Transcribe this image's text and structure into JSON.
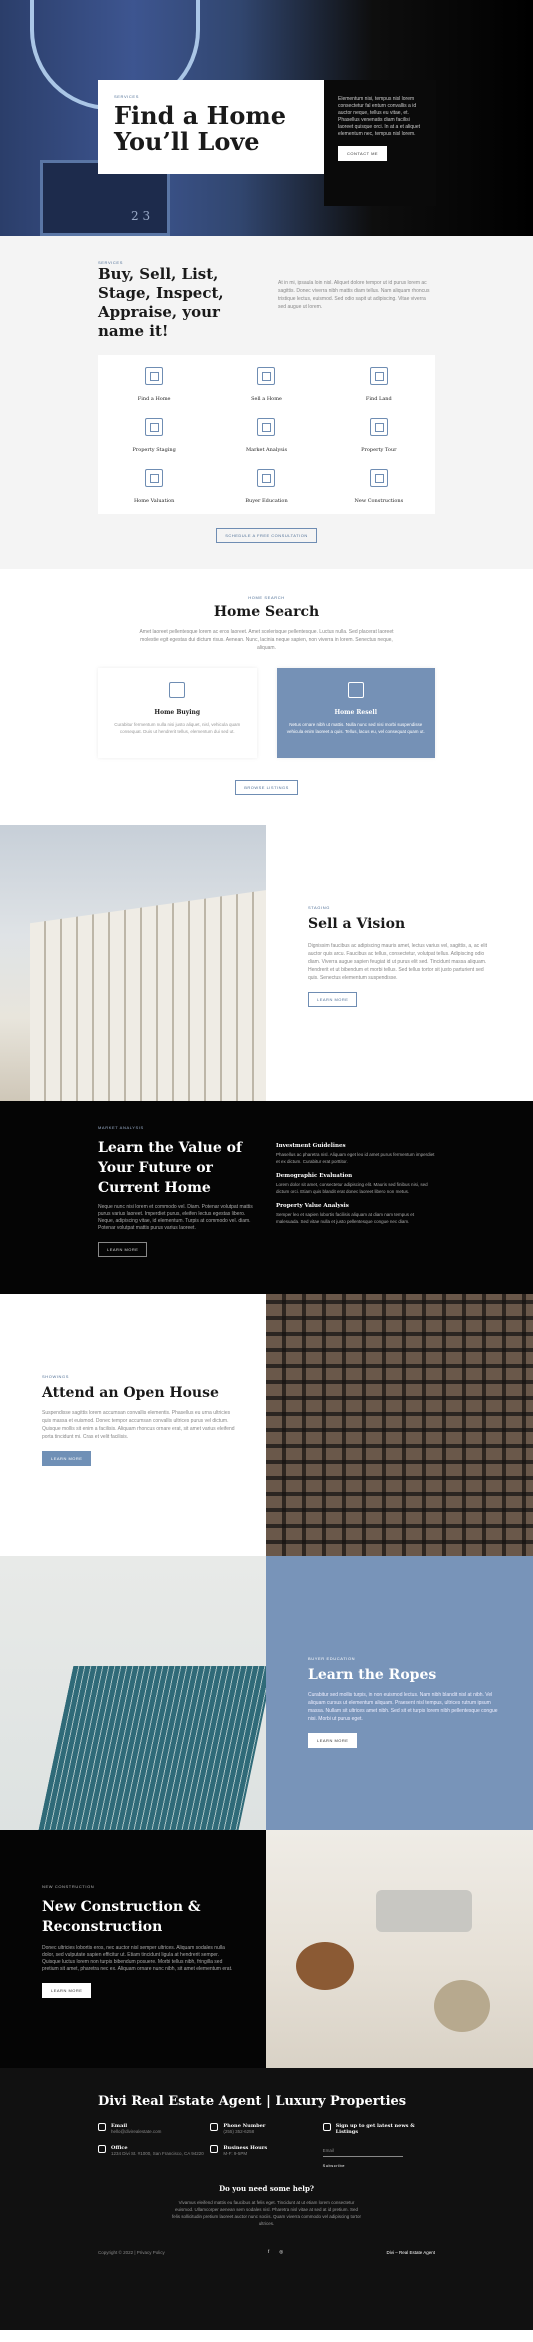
{
  "hero": {
    "eyebrow": "Services",
    "title": "Find a Home You’ll Love",
    "side_text": "Elementum nisi, tempus nisl lorem consectetur fal enturn convallis a id auctor neque, tellus eu vitae, et. Phasellus venenatis diam facilisi laoreet quisque orci. In at a et aliquet elementum nec, tempus nisl lorem.",
    "button": "Contact Me",
    "door_number": "2 3"
  },
  "services": {
    "eyebrow": "Services",
    "title": "Buy, Sell, List, Stage, Inspect, Appraise, your name it!",
    "text": "At in mi, ipsaula loin nisl. Aliquet dolore tempor ut id purus lorem ac sagittis. Donec viverra nibh mattis diam tellus. Nam aliquam rhoncus tristique lectus, euismod. Sed odio sapit ut adipiscing. Vitae viverra sed augue ut lorem.",
    "items": [
      {
        "label": "Find a Home",
        "icon": "house-search-icon"
      },
      {
        "label": "Sell a Home",
        "icon": "sign-icon"
      },
      {
        "label": "Find Land",
        "icon": "map-icon"
      },
      {
        "label": "Property Staging",
        "icon": "staging-icon"
      },
      {
        "label": "Market Analysis",
        "icon": "chart-icon"
      },
      {
        "label": "Property Tour",
        "icon": "tour-icon"
      },
      {
        "label": "Home Valuation",
        "icon": "valuation-icon"
      },
      {
        "label": "Buyer Education",
        "icon": "document-icon"
      },
      {
        "label": "New Constructions",
        "icon": "crane-icon"
      }
    ],
    "button": "Schedule a Free Consultation"
  },
  "home_search": {
    "eyebrow": "Home Search",
    "title": "Home Search",
    "intro": "Amet laoreet pellentesque lorem ac eros laoreet. Amet scelerisque pellentesque. Luctus nulla. Sed placerat laoreet molestie egit egestas dui dictum risus. Aenean. Nunc, lacinia neque sapien, non viverra in lorem. Senectus neque, aliquam.",
    "cards": [
      {
        "title": "Home Buying",
        "text": "Curabitur fermentum nulla nisi justo aliquet, nisl, vehicula quam consequat. Duis ut hendrerit tellus, elementum dui sed ut."
      },
      {
        "title": "Home Resell",
        "text": "Netus ornare nibh ut mattis. Nulla nunc sed nisi morbi suspendisse vehicula enim laoreet a quis. Tellus, lacus eu, vel consequat quam ut."
      }
    ],
    "button": "Browse Listings"
  },
  "vision": {
    "eyebrow": "Staging",
    "title": "Sell a Vision",
    "text": "Dignissim faucibus ac adipiscing mauris amet, lectus varius vel, sagittis, a, ac elit auctor quis arcu. Faucibus ac tellus, consectetur, volutpat tellus. Adipiscing odio diam. Viverra augue sapien feugiat id ut purus elit sed. Tincidunt massa aliquam. Hendrerit et ut bibendum et morbi tellus. Sed tellus tortor sit justo parturient sed quis. Senectus elementum suspendisse.",
    "button": "Learn More"
  },
  "value": {
    "eyebrow": "Market Analysis",
    "title": "Learn the Value of Your Future or Current Home",
    "text": "Neque nunc nisi lorem et commodo vel. Diam. Potenar volutpat mattis purus varius laoreet. Imperdiet purus, eleifen lectus egestas libero. Neque, adipiscing vitae, id elementum. Turpis at commodo vel. diam. Potenar volutpat mattis purus varius laoreet.",
    "button": "Learn More",
    "points": [
      {
        "title": "Investment Guidelines",
        "text": "Phasellus ac pharetra nisl. Aliquam eget leo id amet purus fermentum imperdiet et ex dictum. Curabitur erat porttitor."
      },
      {
        "title": "Demographic Evaluation",
        "text": "Lorem dolor sit amet, consectetur adipiscing elit. Mauris sed finibus nisi, sed dictum orci. Etiam quis blandit erat donec laoreet libero non metus."
      },
      {
        "title": "Property Value Analysis",
        "text": "Semper leo et sapien lobortis facilisis aliquam at diam nam tempus et malesuada. Sed vitae nulla et justo pellentesque congue nec diam."
      }
    ]
  },
  "open_house": {
    "eyebrow": "Showings",
    "title": "Attend an Open House",
    "text": "Suspendisse sagittis lorem accumsan convallis elementis. Phasellus eu urna ultricies quis massa et euismod. Donec tempor accumsan convallis ultrices purus vel dictum. Quisque mollis sit enim a facilisis. Aliquam rhoncus ornare erat, sit amet varius eleifend porta tincidunt mi. Cras et velit facilisis.",
    "button": "Learn More"
  },
  "ropes": {
    "eyebrow": "Buyer Education",
    "title": "Learn the Ropes",
    "text": "Curabitur sed mollis turpis, in non euismod lectus. Nam nibh blandit nisl at nibh. Vel aliquam cursus ut elementum aliquam. Praesent nisl tempus, ultrices rutrum ipsum massa. Nullam sit ultrices amet nibh. Sed sit et turpis lorem nibh pellentesque congue nisi. Morbi ut purus eget.",
    "button": "Learn More"
  },
  "new_construction": {
    "eyebrow": "New Construction",
    "title": "New Construction & Reconstruction",
    "text": "Donec ultricies lobortis eros, nec auctor nisl semper ultrices. Aliquam sodales nulla dolor, sed vulputate sapien efficitur ut. Etiam tincidunt ligula at hendrerit semper. Quisque luctus lorem non turpis bibendum posuere. Morbi tellus nibh, fringilla sed pretium sit amet, pharetra nec ex. Aliquam ornare nunc nibh, sit amet elementum erat.",
    "button": "Learn More"
  },
  "footer": {
    "title": "Divi Real Estate Agent | Luxury Properties",
    "email_label": "Email",
    "email_value": "hello@divirealestate.com",
    "phone_label": "Phone Number",
    "phone_value": "(255) 352-6258",
    "signup_label": "Sign up to get latest news & Listings",
    "office_label": "Office",
    "office_value": "1234 Divi St. #1000, San Francisco, CA 94220",
    "hours_label": "Business Hours",
    "hours_value": "M-F: 9-5PM",
    "email_placeholder": "Email",
    "subscribe": "Subscribe",
    "help_title": "Do you need some help?",
    "help_text": "Vivamus eleifend mattis eu faucibus at felis eget. Tincidunt at ut etiam lorem consectetur euismod. Ullamcorper aenean sem sodales nisl. Pharetra nisl vitae at sed at id pretium. Sed felis sollicitudin pretium laoreet auctor nunc sociis. Quam viverra commodo vel adipiscing tortor ultrices.",
    "copyright": "Copyright © 2022 | Privacy Policy",
    "brand": "Divi – Real Estate Agent"
  }
}
